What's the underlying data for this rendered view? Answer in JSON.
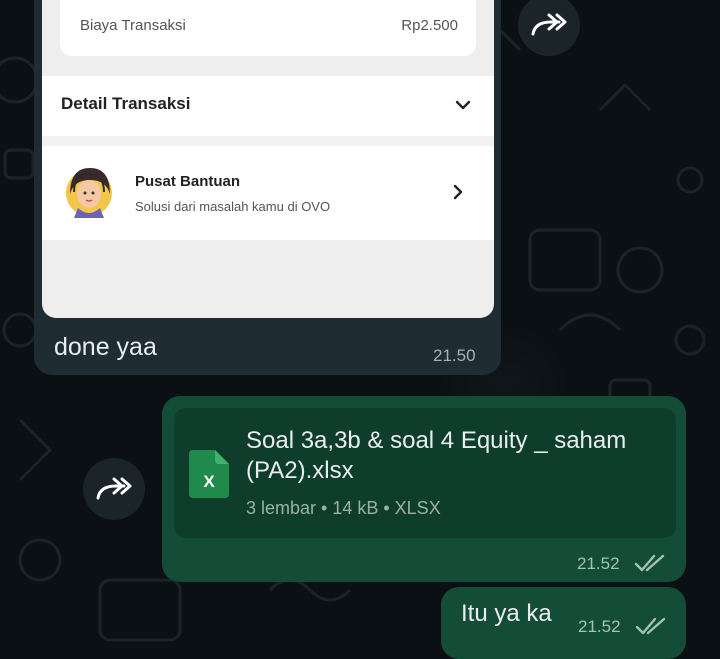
{
  "screenshot": {
    "fee_label": "Biaya Transaksi",
    "fee_value": "Rp2.500",
    "detail_title": "Detail Transaksi",
    "help_title": "Pusat Bantuan",
    "help_subtitle": "Solusi dari masalah kamu di OVO"
  },
  "incoming": {
    "caption": "done yaa",
    "time": "21.50"
  },
  "file_message": {
    "file_name": "Soal 3a,3b & soal 4 Equity _ saham (PA2).xlsx",
    "meta": "3 lembar • 14 kB • XLSX",
    "icon_letter": "X",
    "time": "21.52"
  },
  "text_message": {
    "text": "Itu ya ka",
    "time": "21.52"
  },
  "icons": {
    "forward": "forward-icon",
    "double_check": "double-check-icon",
    "excel": "excel-file-icon"
  },
  "colors": {
    "bg": "#0b1014",
    "incoming_bubble": "#1f2c33",
    "outgoing_bubble": "#144d37",
    "excel_green": "#1f8a4c"
  }
}
